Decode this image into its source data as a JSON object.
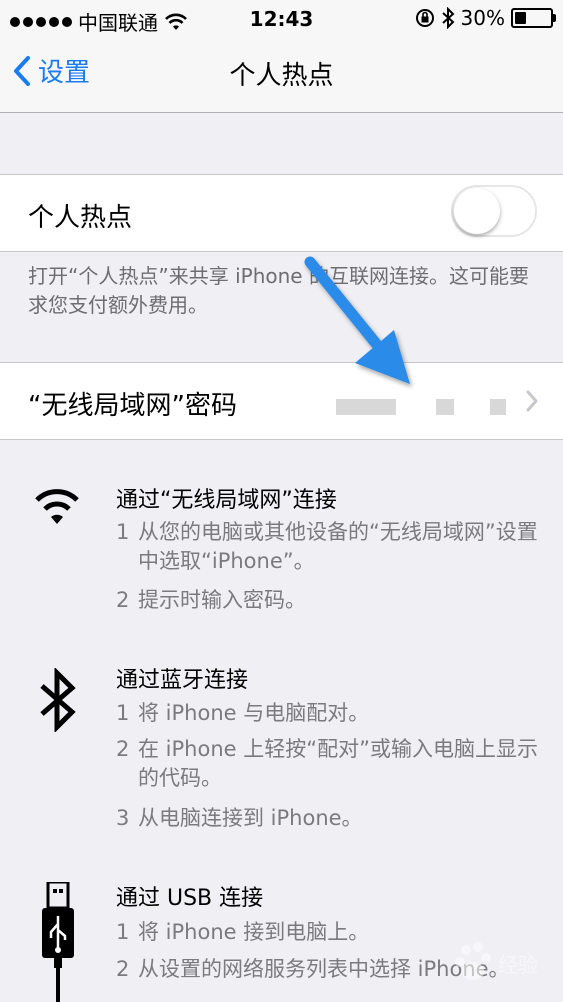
{
  "status_bar": {
    "carrier": "中国联通",
    "time": "12:43",
    "battery": "30%",
    "battery_level": 0.3
  },
  "nav": {
    "back_label": "设置",
    "title": "个人热点"
  },
  "hotspot": {
    "label": "个人热点",
    "enabled": false,
    "footnote": "打开“个人热点”来共享 iPhone 的互联网连接。这可能要求您支付额外费用。"
  },
  "wifi_password": {
    "label": "“无线局域网”密码"
  },
  "sections": [
    {
      "icon": "wifi-icon",
      "title": "通过“无线局域网”连接",
      "steps": [
        {
          "num": "1",
          "text": "从您的电脑或其他设备的“无线局域网”设置中选取“iPhone”。"
        },
        {
          "num": "2",
          "text": "提示时输入密码。"
        }
      ]
    },
    {
      "icon": "bluetooth-icon",
      "title": "通过蓝牙连接",
      "steps": [
        {
          "num": "1",
          "text": "将 iPhone 与电脑配对。"
        },
        {
          "num": "2",
          "text": "在 iPhone 上轻按“配对”或输入电脑上显示的代码。"
        },
        {
          "num": "3",
          "text": "从电脑连接到 iPhone。"
        }
      ]
    },
    {
      "icon": "usb-icon",
      "title": "通过 USB 连接",
      "steps": [
        {
          "num": "1",
          "text": "将 iPhone 接到电脑上。"
        },
        {
          "num": "2",
          "text": "从设置的网络服务列表中选择 iPhone。"
        }
      ]
    }
  ],
  "colors": {
    "accent": "#1a7cf5",
    "background": "#efeff4",
    "annotation_arrow": "#2a8be8"
  },
  "watermark": "Bai 经验"
}
